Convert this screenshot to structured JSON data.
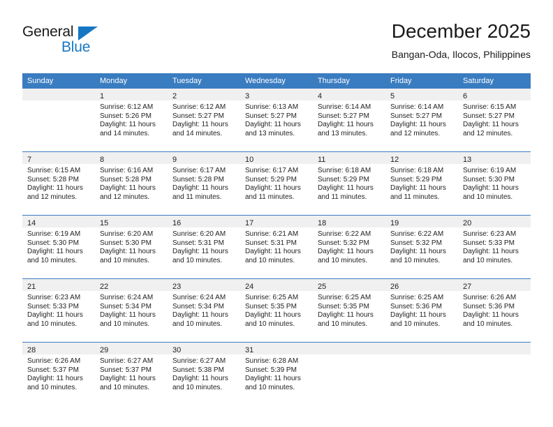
{
  "logo": {
    "word_top": "General",
    "word_bottom": "Blue",
    "triangle_icon": "blue-triangle-icon",
    "accent_color": "#1577c4"
  },
  "header": {
    "title": "December 2025",
    "subtitle": "Bangan-Oda, Ilocos, Philippines"
  },
  "theme": {
    "header_bar_color": "#3a7cc0",
    "day_band_color": "#f0f0f0",
    "text_color": "#222222"
  },
  "calendar": {
    "weekday_headers": [
      "Sunday",
      "Monday",
      "Tuesday",
      "Wednesday",
      "Thursday",
      "Friday",
      "Saturday"
    ],
    "weeks": [
      [
        {
          "day": "",
          "sunrise": "",
          "sunset": "",
          "daylight": "",
          "empty": true
        },
        {
          "day": "1",
          "sunrise": "Sunrise: 6:12 AM",
          "sunset": "Sunset: 5:26 PM",
          "daylight": "Daylight: 11 hours and 14 minutes."
        },
        {
          "day": "2",
          "sunrise": "Sunrise: 6:12 AM",
          "sunset": "Sunset: 5:27 PM",
          "daylight": "Daylight: 11 hours and 14 minutes."
        },
        {
          "day": "3",
          "sunrise": "Sunrise: 6:13 AM",
          "sunset": "Sunset: 5:27 PM",
          "daylight": "Daylight: 11 hours and 13 minutes."
        },
        {
          "day": "4",
          "sunrise": "Sunrise: 6:14 AM",
          "sunset": "Sunset: 5:27 PM",
          "daylight": "Daylight: 11 hours and 13 minutes."
        },
        {
          "day": "5",
          "sunrise": "Sunrise: 6:14 AM",
          "sunset": "Sunset: 5:27 PM",
          "daylight": "Daylight: 11 hours and 12 minutes."
        },
        {
          "day": "6",
          "sunrise": "Sunrise: 6:15 AM",
          "sunset": "Sunset: 5:27 PM",
          "daylight": "Daylight: 11 hours and 12 minutes."
        }
      ],
      [
        {
          "day": "7",
          "sunrise": "Sunrise: 6:15 AM",
          "sunset": "Sunset: 5:28 PM",
          "daylight": "Daylight: 11 hours and 12 minutes."
        },
        {
          "day": "8",
          "sunrise": "Sunrise: 6:16 AM",
          "sunset": "Sunset: 5:28 PM",
          "daylight": "Daylight: 11 hours and 12 minutes."
        },
        {
          "day": "9",
          "sunrise": "Sunrise: 6:17 AM",
          "sunset": "Sunset: 5:28 PM",
          "daylight": "Daylight: 11 hours and 11 minutes."
        },
        {
          "day": "10",
          "sunrise": "Sunrise: 6:17 AM",
          "sunset": "Sunset: 5:29 PM",
          "daylight": "Daylight: 11 hours and 11 minutes."
        },
        {
          "day": "11",
          "sunrise": "Sunrise: 6:18 AM",
          "sunset": "Sunset: 5:29 PM",
          "daylight": "Daylight: 11 hours and 11 minutes."
        },
        {
          "day": "12",
          "sunrise": "Sunrise: 6:18 AM",
          "sunset": "Sunset: 5:29 PM",
          "daylight": "Daylight: 11 hours and 11 minutes."
        },
        {
          "day": "13",
          "sunrise": "Sunrise: 6:19 AM",
          "sunset": "Sunset: 5:30 PM",
          "daylight": "Daylight: 11 hours and 10 minutes."
        }
      ],
      [
        {
          "day": "14",
          "sunrise": "Sunrise: 6:19 AM",
          "sunset": "Sunset: 5:30 PM",
          "daylight": "Daylight: 11 hours and 10 minutes."
        },
        {
          "day": "15",
          "sunrise": "Sunrise: 6:20 AM",
          "sunset": "Sunset: 5:30 PM",
          "daylight": "Daylight: 11 hours and 10 minutes."
        },
        {
          "day": "16",
          "sunrise": "Sunrise: 6:20 AM",
          "sunset": "Sunset: 5:31 PM",
          "daylight": "Daylight: 11 hours and 10 minutes."
        },
        {
          "day": "17",
          "sunrise": "Sunrise: 6:21 AM",
          "sunset": "Sunset: 5:31 PM",
          "daylight": "Daylight: 11 hours and 10 minutes."
        },
        {
          "day": "18",
          "sunrise": "Sunrise: 6:22 AM",
          "sunset": "Sunset: 5:32 PM",
          "daylight": "Daylight: 11 hours and 10 minutes."
        },
        {
          "day": "19",
          "sunrise": "Sunrise: 6:22 AM",
          "sunset": "Sunset: 5:32 PM",
          "daylight": "Daylight: 11 hours and 10 minutes."
        },
        {
          "day": "20",
          "sunrise": "Sunrise: 6:23 AM",
          "sunset": "Sunset: 5:33 PM",
          "daylight": "Daylight: 11 hours and 10 minutes."
        }
      ],
      [
        {
          "day": "21",
          "sunrise": "Sunrise: 6:23 AM",
          "sunset": "Sunset: 5:33 PM",
          "daylight": "Daylight: 11 hours and 10 minutes."
        },
        {
          "day": "22",
          "sunrise": "Sunrise: 6:24 AM",
          "sunset": "Sunset: 5:34 PM",
          "daylight": "Daylight: 11 hours and 10 minutes."
        },
        {
          "day": "23",
          "sunrise": "Sunrise: 6:24 AM",
          "sunset": "Sunset: 5:34 PM",
          "daylight": "Daylight: 11 hours and 10 minutes."
        },
        {
          "day": "24",
          "sunrise": "Sunrise: 6:25 AM",
          "sunset": "Sunset: 5:35 PM",
          "daylight": "Daylight: 11 hours and 10 minutes."
        },
        {
          "day": "25",
          "sunrise": "Sunrise: 6:25 AM",
          "sunset": "Sunset: 5:35 PM",
          "daylight": "Daylight: 11 hours and 10 minutes."
        },
        {
          "day": "26",
          "sunrise": "Sunrise: 6:25 AM",
          "sunset": "Sunset: 5:36 PM",
          "daylight": "Daylight: 11 hours and 10 minutes."
        },
        {
          "day": "27",
          "sunrise": "Sunrise: 6:26 AM",
          "sunset": "Sunset: 5:36 PM",
          "daylight": "Daylight: 11 hours and 10 minutes."
        }
      ],
      [
        {
          "day": "28",
          "sunrise": "Sunrise: 6:26 AM",
          "sunset": "Sunset: 5:37 PM",
          "daylight": "Daylight: 11 hours and 10 minutes."
        },
        {
          "day": "29",
          "sunrise": "Sunrise: 6:27 AM",
          "sunset": "Sunset: 5:37 PM",
          "daylight": "Daylight: 11 hours and 10 minutes."
        },
        {
          "day": "30",
          "sunrise": "Sunrise: 6:27 AM",
          "sunset": "Sunset: 5:38 PM",
          "daylight": "Daylight: 11 hours and 10 minutes."
        },
        {
          "day": "31",
          "sunrise": "Sunrise: 6:28 AM",
          "sunset": "Sunset: 5:39 PM",
          "daylight": "Daylight: 11 hours and 10 minutes."
        },
        {
          "day": "",
          "sunrise": "",
          "sunset": "",
          "daylight": "",
          "empty": true
        },
        {
          "day": "",
          "sunrise": "",
          "sunset": "",
          "daylight": "",
          "empty": true
        },
        {
          "day": "",
          "sunrise": "",
          "sunset": "",
          "daylight": "",
          "empty": true
        }
      ]
    ]
  }
}
